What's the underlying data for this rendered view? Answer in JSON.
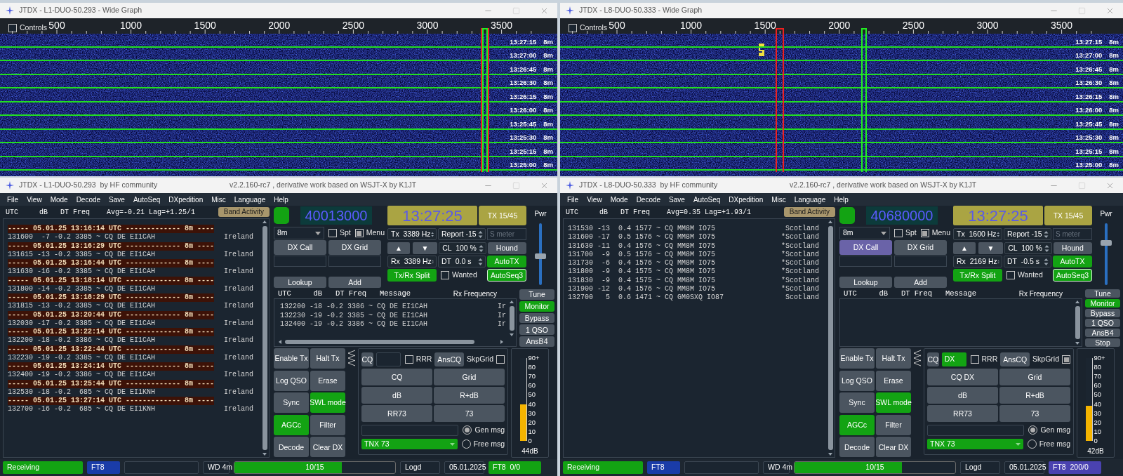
{
  "stations": [
    {
      "waterfall": {
        "title": "JTDX - L1-DUO-50.293 - Wide Graph",
        "controls": {
          "label": "Controls",
          "checked": false
        },
        "scale": [
          "500",
          "1000",
          "1500",
          "2000",
          "2500",
          "3000",
          "3500"
        ],
        "rows": [
          {
            "time": "13:27:15",
            "band": "8m"
          },
          {
            "time": "13:27:00",
            "band": "8m"
          },
          {
            "time": "13:26:45",
            "band": "8m"
          },
          {
            "time": "13:26:30",
            "band": "8m"
          },
          {
            "time": "13:26:15",
            "band": "8m"
          },
          {
            "time": "13:26:00",
            "band": "8m"
          },
          {
            "time": "13:25:45",
            "band": "8m"
          },
          {
            "time": "13:25:30",
            "band": "8m"
          },
          {
            "time": "13:25:15",
            "band": "8m"
          },
          {
            "time": "13:25:00",
            "band": "8m"
          }
        ]
      },
      "main": {
        "title": "JTDX - L1-DUO-50.293  by HF community",
        "subtitle": "v2.2.160-rc7 , derivative work based on WSJT-X by K1JT",
        "menu": [
          "File",
          "View",
          "Mode",
          "Decode",
          "Save",
          "AutoSeq",
          "DXpedition",
          "Misc",
          "Language",
          "Help"
        ],
        "band_activity": {
          "header": "UTC     dB   DT Freq    Avg=-0.21 Lag=+1.25/1",
          "button": "Band Activity",
          "lines": [
            {
              "kind": "separator",
              "text": "----- 05.01.25 13:16:14 UTC ------------- 8m ----"
            },
            {
              "kind": "decode",
              "text": "131600  -7 -0.2 3385 ~ CQ DE EI1CAH",
              "country": "Ireland"
            },
            {
              "kind": "separator",
              "text": "----- 05.01.25 13:16:29 UTC ------------- 8m ----"
            },
            {
              "kind": "decode",
              "text": "131615 -13 -0.2 3385 ~ CQ DE EI1CAH",
              "country": "Ireland"
            },
            {
              "kind": "separator",
              "text": "----- 05.01.25 13:16:44 UTC ------------- 8m ----"
            },
            {
              "kind": "decode",
              "text": "131630 -16 -0.2 3385 ~ CQ DE EI1CAH",
              "country": "Ireland"
            },
            {
              "kind": "separator",
              "text": "----- 05.01.25 13:18:14 UTC ------------- 8m ----"
            },
            {
              "kind": "decode",
              "text": "131800 -14 -0.2 3385 ~ CQ DE EI1CAH",
              "country": "Ireland"
            },
            {
              "kind": "separator",
              "text": "----- 05.01.25 13:18:29 UTC ------------- 8m ----"
            },
            {
              "kind": "decode",
              "text": "131815 -13 -0.2 3385 ~ CQ DE EI1CAH",
              "country": "Ireland"
            },
            {
              "kind": "separator",
              "text": "----- 05.01.25 13:20:44 UTC ------------- 8m ----"
            },
            {
              "kind": "decode",
              "text": "132030 -17 -0.2 3385 ~ CQ DE EI1CAH",
              "country": "Ireland"
            },
            {
              "kind": "separator",
              "text": "----- 05.01.25 13:22:14 UTC ------------- 8m ----"
            },
            {
              "kind": "decode",
              "text": "132200 -18 -0.2 3386 ~ CQ DE EI1CAH",
              "country": "Ireland"
            },
            {
              "kind": "separator",
              "text": "----- 05.01.25 13:22:44 UTC ------------- 8m ----"
            },
            {
              "kind": "decode",
              "text": "132230 -19 -0.2 3385 ~ CQ DE EI1CAH",
              "country": "Ireland"
            },
            {
              "kind": "separator",
              "text": "----- 05.01.25 13:24:14 UTC ------------- 8m ----"
            },
            {
              "kind": "decode",
              "text": "132400 -19 -0.2 3386 ~ CQ DE EI1CAH",
              "country": "Ireland"
            },
            {
              "kind": "separator",
              "text": "----- 05.01.25 13:25:44 UTC ------------- 8m ----"
            },
            {
              "kind": "decode",
              "text": "132530 -18 -0.2  685 ~ CQ DE EI1KNH",
              "country": "Ireland"
            },
            {
              "kind": "separator",
              "text": "----- 05.01.25 13:27:14 UTC ------------- 8m ----"
            },
            {
              "kind": "decode",
              "text": "132700 -16 -0.2  685 ~ CQ DE EI1KNH",
              "country": "Ireland"
            }
          ]
        },
        "monitor_led": {
          "on": true
        },
        "dial_frequency": "40013000",
        "clock": "13:27:25",
        "tx_period": {
          "label": "TX 15/45",
          "kind": "olive"
        },
        "power": {
          "label": "Pwr",
          "level": 0.45
        },
        "band": "8m",
        "spt": {
          "label": "Spt",
          "checked": false
        },
        "menu_toggle": {
          "label": "Menu",
          "checked": true
        },
        "tx_freq": "Tx  3389 Hz",
        "report": "Report -15",
        "s_meter": {
          "placeholder": "S meter"
        },
        "dx_call": {
          "label": "DX Call",
          "kind": "plain"
        },
        "dx_grid": {
          "label": "DX Grid",
          "kind": "plain"
        },
        "up": "▲",
        "down": "▼",
        "cl": "CL  100 %",
        "hound": {
          "label": "Hound",
          "kind": "plain"
        },
        "rx_freq": "Rx  3389 Hz",
        "dt": "DT  0.0 s",
        "autotx": {
          "label": "AutoTX",
          "kind": "green"
        },
        "split": {
          "label": "Tx/Rx Split",
          "kind": "green"
        },
        "wanted": {
          "label": "Wanted",
          "checked": false
        },
        "autoseq": {
          "label": "AutoSeq3",
          "kind": "outlined"
        },
        "lookup": {
          "label": "Lookup",
          "kind": "plain"
        },
        "add": {
          "label": "Add",
          "kind": "plain"
        },
        "rx_panel": {
          "header": "UTC     dB   DT Freq   Message",
          "title": "Rx Frequency",
          "hscroll": true,
          "lines": [
            {
              "text": "132200 -18 -0.2 3386 ~ CQ DE EI1CAH",
              "country": "Ir"
            },
            {
              "text": "132230 -19 -0.2 3385 ~ CQ DE EI1CAH",
              "country": "Ir"
            },
            {
              "text": "132400 -19 -0.2 3386 ~ CQ DE EI1CAH",
              "country": "Ir"
            }
          ]
        },
        "side_buttons": [
          {
            "label": "Tune",
            "kind": "plain"
          },
          {
            "label": "Monitor",
            "kind": "green"
          },
          {
            "label": "Bypass",
            "kind": "plain"
          },
          {
            "label": "1 QSO",
            "kind": "plain"
          },
          {
            "label": "AnsB4",
            "kind": "plain"
          }
        ],
        "control_buttons": [
          {
            "label": "Enable Tx",
            "kind": "plain"
          },
          {
            "label": "Halt Tx",
            "kind": "plain"
          },
          {
            "label": "Log QSO",
            "kind": "plain"
          },
          {
            "label": "Erase",
            "kind": "plain"
          },
          {
            "label": "Sync",
            "kind": "plain"
          },
          {
            "label": "SWL mode",
            "kind": "green"
          },
          {
            "label": "AGCc",
            "kind": "green"
          },
          {
            "label": "Filter",
            "kind": "plain"
          },
          {
            "label": "Decode",
            "kind": "plain"
          },
          {
            "label": "Clear DX",
            "kind": "plain"
          }
        ],
        "message_panel": {
          "cq": {
            "label": "CQ",
            "kind": "plain"
          },
          "cq_field": {
            "highlighted": false
          },
          "rrr": {
            "label": "RRR",
            "checked": false
          },
          "anscq": {
            "label": "AnsCQ",
            "kind": "plain"
          },
          "skpgrid": {
            "label": "SkpGrid",
            "checked": false
          },
          "messages": [
            {
              "label": "CQ",
              "kind": "plain"
            },
            {
              "label": "Grid",
              "kind": "plain"
            },
            {
              "label": "dB",
              "kind": "plain"
            },
            {
              "label": "R+dB",
              "kind": "plain"
            },
            {
              "label": "RR73",
              "kind": "plain"
            },
            {
              "label": "73",
              "kind": "plain"
            }
          ],
          "free_text": "TNX 73",
          "gen": {
            "label": "Gen msg",
            "selected": true
          },
          "free": {
            "label": "Free msg",
            "selected": false
          }
        },
        "meter": {
          "scale": [
            "90+",
            "80",
            "70",
            "60",
            "50",
            "40",
            "30",
            "20",
            "10",
            "0"
          ],
          "level": 0.44,
          "reading": "44dB"
        },
        "status_bar": [
          {
            "kind": "green",
            "text": "Receiving"
          },
          {
            "kind": "blue",
            "text": "FT8"
          },
          {
            "kind": "empty"
          },
          {
            "kind": "plain",
            "text": "WD 4m"
          },
          {
            "kind": "progress",
            "text": "10/15",
            "level": 0.67
          },
          {
            "kind": "plain",
            "text": "Logd"
          },
          {
            "kind": "plain",
            "text": "05.01.2025"
          },
          {
            "kind": "green",
            "text": "FT8  0/0"
          }
        ]
      }
    },
    {
      "waterfall": {
        "title": "JTDX - L8-DUO-50.333 - Wide Graph",
        "controls": {
          "label": "Controls",
          "checked": false
        },
        "scale": [
          "500",
          "1000",
          "1500",
          "2000",
          "2500",
          "3000",
          "3500"
        ],
        "signals": [
          {
            "level": 0.358
          }
        ],
        "rows": [
          {
            "time": "13:27:15",
            "band": "8m"
          },
          {
            "time": "13:27:00",
            "band": "8m"
          },
          {
            "time": "13:26:45",
            "band": "8m"
          },
          {
            "time": "13:26:30",
            "band": "8m"
          },
          {
            "time": "13:26:15",
            "band": "8m"
          },
          {
            "time": "13:26:00",
            "band": "8m"
          },
          {
            "time": "13:25:45",
            "band": "8m"
          },
          {
            "time": "13:25:30",
            "band": "8m"
          },
          {
            "time": "13:25:15",
            "band": "8m"
          },
          {
            "time": "13:25:00",
            "band": "8m"
          }
        ]
      },
      "main": {
        "title": "JTDX - L8-DUO-50.333  by HF community",
        "subtitle": "v2.2.160-rc7 , derivative work based on WSJT-X by K1JT",
        "menu": [
          "File",
          "View",
          "Mode",
          "Decode",
          "Save",
          "AutoSeq",
          "DXpedition",
          "Misc",
          "Language",
          "Help"
        ],
        "band_activity": {
          "header": "UTC     dB   DT Freq    Avg=0.35 Lag=+1.93/1",
          "button": "Band Activity",
          "lines": [
            {
              "kind": "decode",
              "text": "131530 -13  0.4 1577 ~ CQ MM8M IO75",
              "country": "Scotland"
            },
            {
              "kind": "decode",
              "text": "131600 -17  0.5 1576 ~ CQ MM8M IO75",
              "country": "*Scotland"
            },
            {
              "kind": "decode",
              "text": "131630 -11  0.4 1576 ~ CQ MM8M IO75",
              "country": "*Scotland"
            },
            {
              "kind": "decode",
              "text": "131700  -9  0.5 1576 ~ CQ MM8M IO75",
              "country": "*Scotland"
            },
            {
              "kind": "decode",
              "text": "131730  -6  0.4 1576 ~ CQ MM8M IO75",
              "country": "*Scotland"
            },
            {
              "kind": "decode",
              "text": "131800  -9  0.4 1575 ~ CQ MM8M IO75",
              "country": "*Scotland"
            },
            {
              "kind": "decode",
              "text": "131830  -9  0.4 1575 ~ CQ MM8M IO75",
              "country": "*Scotland"
            },
            {
              "kind": "decode",
              "text": "131900 -12  0.4 1576 ~ CQ MM8M IO75",
              "country": "*Scotland"
            },
            {
              "kind": "decode",
              "text": "132700   5  0.6 1471 ~ CQ GM0SXQ IO87",
              "country": "Scotland"
            }
          ]
        },
        "monitor_led": {
          "on": true
        },
        "dial_frequency": "40680000",
        "clock": "13:27:25",
        "tx_period": {
          "label": "TX 15/45",
          "kind": "olive"
        },
        "power": {
          "label": "Pwr",
          "level": 0.65
        },
        "band": "8m",
        "spt": {
          "label": "Spt",
          "checked": false
        },
        "menu_toggle": {
          "label": "Menu",
          "checked": true
        },
        "tx_freq": "Tx  1600 Hz",
        "report": "Report -15",
        "s_meter": {
          "placeholder": "S meter"
        },
        "dx_call": {
          "label": "DX Call",
          "kind": "purple"
        },
        "dx_grid": {
          "label": "DX Grid",
          "kind": "plain"
        },
        "up": "▲",
        "down": "▼",
        "cl": "CL  100 %",
        "hound": {
          "label": "Hound",
          "kind": "plain"
        },
        "rx_freq": "Rx  2169 Hz",
        "dt": "DT  -0.5 s",
        "autotx": {
          "label": "AutoTX",
          "kind": "green"
        },
        "split": {
          "label": "Tx/Rx Split",
          "kind": "green"
        },
        "wanted": {
          "label": "Wanted",
          "checked": false
        },
        "autoseq": {
          "label": "AutoSeq3",
          "kind": "outlined"
        },
        "lookup": {
          "label": "Lookup",
          "kind": "plain"
        },
        "add": {
          "label": "Add",
          "kind": "plain"
        },
        "rx_panel": {
          "header": "UTC     dB   DT Freq   Message",
          "title": "Rx Frequency",
          "hscroll": false
        },
        "side_buttons": [
          {
            "label": "Tune",
            "kind": "plain"
          },
          {
            "label": "Monitor",
            "kind": "green"
          },
          {
            "label": "Bypass",
            "kind": "plain"
          },
          {
            "label": "1 QSO",
            "kind": "plain"
          },
          {
            "label": "AnsB4",
            "kind": "plain"
          },
          {
            "label": "Stop",
            "kind": "plain"
          }
        ],
        "control_buttons": [
          {
            "label": "Enable Tx",
            "kind": "plain"
          },
          {
            "label": "Halt Tx",
            "kind": "plain"
          },
          {
            "label": "Log QSO",
            "kind": "plain"
          },
          {
            "label": "Erase",
            "kind": "plain"
          },
          {
            "label": "Sync",
            "kind": "plain"
          },
          {
            "label": "SWL mode",
            "kind": "green"
          },
          {
            "label": "AGCc",
            "kind": "green"
          },
          {
            "label": "Filter",
            "kind": "plain"
          },
          {
            "label": "Decode",
            "kind": "plain"
          },
          {
            "label": "Clear DX",
            "kind": "plain"
          }
        ],
        "message_panel": {
          "cq": {
            "label": "CQ",
            "kind": "plain"
          },
          "cq_field": {
            "value": "DX",
            "highlighted": true
          },
          "rrr": {
            "label": "RRR",
            "checked": false
          },
          "anscq": {
            "label": "AnsCQ",
            "kind": "plain"
          },
          "skpgrid": {
            "label": "SkpGrid",
            "checked": true
          },
          "messages": [
            {
              "label": "CQ DX",
              "kind": "plain"
            },
            {
              "label": "Grid",
              "kind": "plain"
            },
            {
              "label": "dB",
              "kind": "plain"
            },
            {
              "label": "R+dB",
              "kind": "plain"
            },
            {
              "label": "RR73",
              "kind": "plain"
            },
            {
              "label": "73",
              "kind": "plain"
            }
          ],
          "free_text": "TNX 73",
          "gen": {
            "label": "Gen msg",
            "selected": true
          },
          "free": {
            "label": "Free msg",
            "selected": false
          }
        },
        "meter": {
          "scale": [
            "90+",
            "80",
            "70",
            "60",
            "50",
            "40",
            "30",
            "20",
            "10",
            "0"
          ],
          "level": 0.42,
          "reading": "42dB"
        },
        "status_bar": [
          {
            "kind": "green",
            "text": "Receiving"
          },
          {
            "kind": "blue",
            "text": "FT8"
          },
          {
            "kind": "empty"
          },
          {
            "kind": "plain",
            "text": "WD 4m"
          },
          {
            "kind": "progress",
            "text": "10/15",
            "level": 0.67
          },
          {
            "kind": "plain",
            "text": "Logd"
          },
          {
            "kind": "plain",
            "text": "05.01.2025"
          },
          {
            "kind": "purple",
            "text": "FT8  200/0"
          }
        ]
      }
    }
  ]
}
